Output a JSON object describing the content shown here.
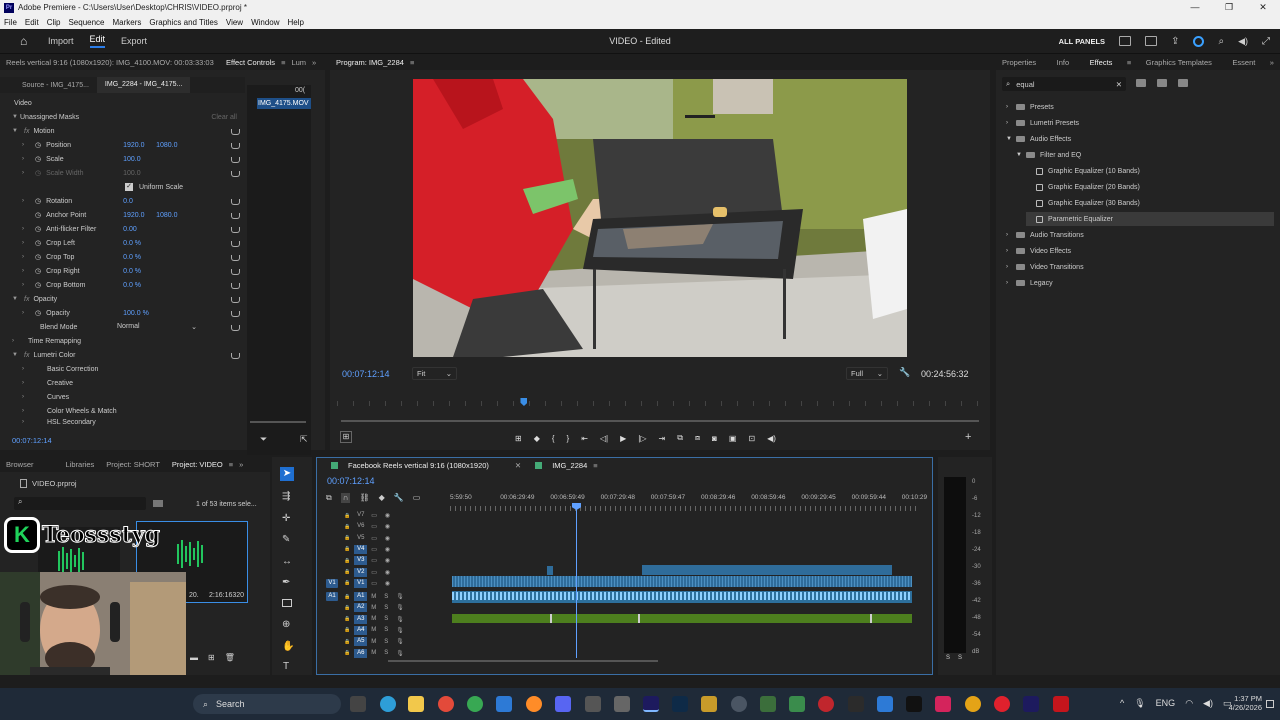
{
  "window": {
    "title": "Adobe Premiere - C:\\Users\\User\\Desktop\\CHRIS\\VIDEO.prproj *"
  },
  "menu": [
    "File",
    "Edit",
    "Clip",
    "Sequence",
    "Markers",
    "Graphics and Titles",
    "View",
    "Window",
    "Help"
  ],
  "header": {
    "import": "Import",
    "edit": "Edit",
    "export": "Export",
    "project_title": "VIDEO - Edited",
    "all_panels": "ALL PANELS"
  },
  "effect_controls": {
    "header_path": "Reels vertical 9:16 (1080x1920): IMG_4100.MOV: 00:03:33:03",
    "tab_ec": "Effect Controls",
    "tab_lumetri": "Lum",
    "source_tab": "Source - IMG_4175...",
    "clip_tab": "IMG_2284 - IMG_4175...",
    "mini_clip": "IMG_4175.MOV",
    "mini_time": "00(",
    "section_video": "Video",
    "clear_all": "Clear all",
    "rows": [
      {
        "label": "Unassigned Masks"
      },
      {
        "label": "Motion"
      },
      {
        "label": "Position",
        "v1": "1920.0",
        "v2": "1080.0"
      },
      {
        "label": "Scale",
        "v1": "100.0"
      },
      {
        "label": "Scale Width",
        "v1": "100.0"
      },
      {
        "label": "Uniform Scale"
      },
      {
        "label": "Rotation",
        "v1": "0.0"
      },
      {
        "label": "Anchor Point",
        "v1": "1920.0",
        "v2": "1080.0"
      },
      {
        "label": "Anti-flicker Filter",
        "v1": "0.00"
      },
      {
        "label": "Crop Left",
        "v1": "0.0 %"
      },
      {
        "label": "Crop Top",
        "v1": "0.0 %"
      },
      {
        "label": "Crop Right",
        "v1": "0.0 %"
      },
      {
        "label": "Crop Bottom",
        "v1": "0.0 %"
      },
      {
        "label": "Opacity"
      },
      {
        "label": "Opacity",
        "v1": "100.0 %"
      },
      {
        "label": "Blend Mode",
        "v1": "Normal"
      },
      {
        "label": "Time Remapping"
      },
      {
        "label": "Lumetri Color"
      },
      {
        "label": "Basic Correction"
      },
      {
        "label": "Creative"
      },
      {
        "label": "Curves"
      },
      {
        "label": "Color Wheels & Match"
      },
      {
        "label": "HSL Secondary"
      }
    ],
    "timecode": "00:07:12:14"
  },
  "program": {
    "title": "Program: IMG_2284",
    "timecode": "00:07:12:14",
    "fit": "Fit",
    "quality": "Full",
    "duration": "00:24:56:32",
    "playhead_fraction": 0.29
  },
  "effects_panel": {
    "tabs": [
      "Properties",
      "Info",
      "Effects",
      "Graphics Templates",
      "Essent"
    ],
    "active_tab": "Effects",
    "search_value": "equal",
    "tree": [
      {
        "label": "Presets",
        "level": 0,
        "kind": "folder"
      },
      {
        "label": "Lumetri Presets",
        "level": 0,
        "kind": "folder"
      },
      {
        "label": "Audio Effects",
        "level": 0,
        "kind": "folder"
      },
      {
        "label": "Filter and EQ",
        "level": 1,
        "kind": "folder"
      },
      {
        "label": "Graphic Equalizer (10 Bands)",
        "level": 2,
        "kind": "fx"
      },
      {
        "label": "Graphic Equalizer (20 Bands)",
        "level": 2,
        "kind": "fx"
      },
      {
        "label": "Graphic Equalizer (30 Bands)",
        "level": 2,
        "kind": "fx"
      },
      {
        "label": "Parametric Equalizer",
        "level": 2,
        "kind": "fx",
        "selected": true
      },
      {
        "label": "Audio Transitions",
        "level": 0,
        "kind": "folder"
      },
      {
        "label": "Video Effects",
        "level": 0,
        "kind": "folder"
      },
      {
        "label": "Video Transitions",
        "level": 0,
        "kind": "folder"
      },
      {
        "label": "Legacy",
        "level": 0,
        "kind": "folder"
      }
    ]
  },
  "project": {
    "tabs": [
      "Browser",
      "Libraries",
      "Project: SHORT",
      "Project: VIDEO"
    ],
    "file": "VIDEO.prproj",
    "count": "1 of 53 items sele...",
    "thumb1_label": "20.",
    "thumb2_label": "2:16:16320",
    "watermark": "Teossstyg"
  },
  "timeline": {
    "tab1": "Facebook Reels vertical 9:16 (1080x1920)",
    "tab2": "IMG_2284",
    "timecode": "00:07:12:14",
    "ruler": [
      "5:59:50",
      "00:06:29:49",
      "00:06:59:49",
      "00:07:29:48",
      "00:07:59:47",
      "00:08:29:46",
      "00:08:59:46",
      "00:09:29:45",
      "00:09:59:44",
      "00:10:29"
    ],
    "video_tracks": [
      "V7",
      "V6",
      "V5",
      "V4",
      "V3",
      "V2",
      "V1"
    ],
    "audio_tracks": [
      "A1",
      "A2",
      "A3",
      "A4",
      "A5",
      "A6"
    ],
    "meter_scale": [
      "0",
      "-6",
      "-12",
      "-18",
      "-24",
      "-30",
      "-36",
      "-42",
      "-48",
      "-54",
      "dB"
    ],
    "meter_footer": [
      "S",
      "S"
    ]
  },
  "taskbar": {
    "search_placeholder": "Search",
    "lang": "ENG",
    "time": "1:37 PM",
    "date": "4/26/2026"
  }
}
